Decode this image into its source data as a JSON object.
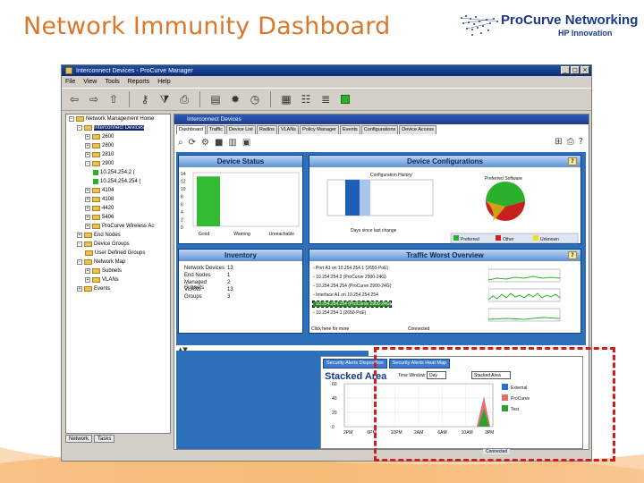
{
  "slide": {
    "title": "Network Immunity Dashboard",
    "logo_name": "ProCurve Networking",
    "logo_sub": "HP Innovation"
  },
  "window": {
    "title": "Interconnect Devices - ProCurve Manager",
    "menu": [
      "File",
      "View",
      "Tools",
      "Reports",
      "Help"
    ]
  },
  "tree": {
    "items": [
      {
        "label": "Network Management Home",
        "level": 0,
        "type": "folder",
        "exp": "-"
      },
      {
        "label": "Interconnect Devices",
        "level": 1,
        "type": "folder",
        "exp": "-",
        "selected": true
      },
      {
        "label": "2600",
        "level": 2,
        "type": "folder",
        "exp": "+"
      },
      {
        "label": "2800",
        "level": 2,
        "type": "folder",
        "exp": "+"
      },
      {
        "label": "2810",
        "level": 2,
        "type": "folder",
        "exp": "+"
      },
      {
        "label": "2900",
        "level": 2,
        "type": "folder",
        "exp": "-"
      },
      {
        "label": "10.254.254.2 (",
        "level": 3,
        "type": "leaf",
        "exp": ""
      },
      {
        "label": "10.254.254.254 (",
        "level": 3,
        "type": "leaf",
        "exp": ""
      },
      {
        "label": "4104",
        "level": 2,
        "type": "folder",
        "exp": "+"
      },
      {
        "label": "4108",
        "level": 2,
        "type": "folder",
        "exp": "+"
      },
      {
        "label": "4420",
        "level": 2,
        "type": "folder",
        "exp": "+"
      },
      {
        "label": "5406",
        "level": 2,
        "type": "folder",
        "exp": "+"
      },
      {
        "label": "ProCurve Wireless Ac",
        "level": 2,
        "type": "folder",
        "exp": "+"
      },
      {
        "label": "End Nodes",
        "level": 1,
        "type": "folder",
        "exp": "+"
      },
      {
        "label": "Device Groups",
        "level": 1,
        "type": "folder",
        "exp": "-"
      },
      {
        "label": "User Defined Groups",
        "level": 2,
        "type": "folder",
        "exp": ""
      },
      {
        "label": "Network Map",
        "level": 1,
        "type": "folder",
        "exp": "-"
      },
      {
        "label": "Subnets",
        "level": 2,
        "type": "folder",
        "exp": "+"
      },
      {
        "label": "VLANs",
        "level": 2,
        "type": "folder",
        "exp": "+"
      },
      {
        "label": "Events",
        "level": 1,
        "type": "folder",
        "exp": "+"
      }
    ],
    "bottom_tabs": [
      "Network",
      "Tasks"
    ]
  },
  "content": {
    "title": "Interconnect Devices",
    "tabs": [
      "Dashboard",
      "Traffic",
      "Device List",
      "Radios",
      "VLANs",
      "Policy Manager",
      "Events",
      "Configurations",
      "Device Access"
    ]
  },
  "device_status": {
    "title": "Device Status",
    "y_ticks": [
      "14",
      "12",
      "10",
      "8",
      "6",
      "4",
      "2",
      "0"
    ],
    "categories": [
      "Good",
      "Warning",
      "Unreachable"
    ],
    "values": [
      13,
      0,
      0
    ],
    "ymax": 14,
    "bar_color": "#33bb33"
  },
  "device_configs": {
    "title": "Device Configurations",
    "history_title": "Configuration History",
    "history_xlabel": "Days since last change",
    "software_title": "Preferred Software",
    "legend": [
      {
        "label": "Preferred",
        "color": "#2bb02b"
      },
      {
        "label": "Other",
        "color": "#d12020"
      },
      {
        "label": "Unknown",
        "color": "#f0e020"
      }
    ]
  },
  "inventory": {
    "title": "Inventory",
    "rows": [
      {
        "k": "Network Devices",
        "v": "13"
      },
      {
        "k": "End Nodes",
        "v": "1"
      },
      {
        "k": "Managed Subnets",
        "v": "2"
      },
      {
        "k": "VLANs",
        "v": "13"
      },
      {
        "k": "Groups",
        "v": "3"
      }
    ]
  },
  "traffic": {
    "title": "Traffic Worst Overview",
    "rows": [
      "Port A1 on 10.254.254.1 (2650-PoE)",
      "10.254.254.2 (ProCurve 2900-24G)",
      "10.254.254.254 (ProCurve 2900-24G)",
      "Interface A1 on 10.254.254.254",
      "10.254.254.254 (ProCurve 2900-24G)",
      "10.254.254.1 (2650-PoE)"
    ],
    "status_left": "Click here for more",
    "status_right": "Connected"
  },
  "stacked": {
    "tabs": [
      "Security Alerts Disposition",
      "Security Alerts Heat Map"
    ],
    "title": "Stacked Area",
    "time_label": "Time Window:",
    "time_value": "Day",
    "type_label": "Stacked Area",
    "y_ticks": [
      "60",
      "40",
      "20",
      "0"
    ],
    "x_ticks": [
      "2PM",
      "6PM",
      "10PM",
      "2AM",
      "6AM",
      "10AM",
      "2PM"
    ],
    "legend": [
      {
        "label": "External",
        "color": "#2a6fd6"
      },
      {
        "label": "ProCurve",
        "color": "#e07070"
      },
      {
        "label": "Test",
        "color": "#30a030"
      }
    ],
    "status": "Connected"
  },
  "colors": {
    "title_orange": "#d9772b",
    "dashboard_blue": "#2d6fb8",
    "highlight_red": "#cc1f1f"
  }
}
